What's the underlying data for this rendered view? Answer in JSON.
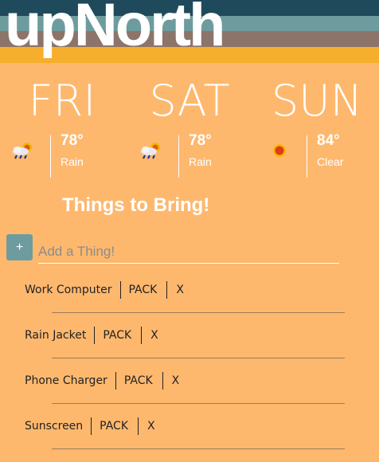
{
  "header": {
    "logo": "upNorth"
  },
  "forecast": [
    {
      "day": "FRI",
      "icon": "rain-sun-icon",
      "temp": "78°",
      "condition": "Rain"
    },
    {
      "day": "SAT",
      "icon": "rain-sun-icon",
      "temp": "78°",
      "condition": "Rain"
    },
    {
      "day": "SUN",
      "icon": "sun-icon",
      "temp": "84°",
      "condition": "Clear"
    }
  ],
  "things": {
    "title": "Things to Bring!",
    "add_label": "+",
    "input_placeholder": "Add a Thing!",
    "items": [
      {
        "name": "Work Computer",
        "pack_label": "PACK",
        "remove_label": "X"
      },
      {
        "name": "Rain Jacket",
        "pack_label": "PACK",
        "remove_label": "X"
      },
      {
        "name": "Phone Charger",
        "pack_label": "PACK",
        "remove_label": "X"
      },
      {
        "name": "Sunscreen",
        "pack_label": "PACK",
        "remove_label": "X"
      }
    ]
  },
  "colors": {
    "background": "#FDB86E",
    "stripe_dark_teal": "#1F4A5C",
    "stripe_teal": "#6E9C9E",
    "stripe_taupe": "#8C746A",
    "stripe_gold": "#F6AE2D"
  }
}
